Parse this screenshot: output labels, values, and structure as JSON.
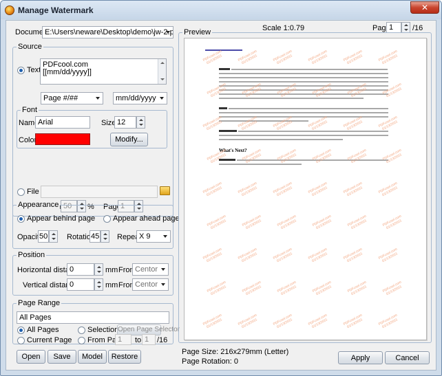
{
  "window": {
    "title": "Manage Watermark",
    "close_glyph": "✕"
  },
  "document": {
    "label": "Document",
    "path": "E:\\Users\\neware\\Desktop\\demo\\jw-2.pdf"
  },
  "source": {
    "title": "Source",
    "text_label": "Text",
    "text_line1": "PDFcool.com",
    "text_line2": "[[mm/dd/yyyy]]",
    "page_format": "Page #/##",
    "date_format": "mm/dd/yyyy",
    "font": {
      "title": "Font",
      "name_label": "Name",
      "name_value": "Arial",
      "size_label": "Size",
      "size_value": "12",
      "color_label": "Color",
      "color_hex": "#ff0000",
      "modify_label": "Modify..."
    },
    "file_label": "File",
    "scaling_label": "Scaling",
    "scaling_value": "50",
    "scaling_unit": "%",
    "page_label": "Page",
    "page_value": "1"
  },
  "appearance": {
    "title": "Appearance",
    "behind_label": "Appear behind page",
    "ahead_label": "Appear ahead page",
    "opacity_label": "Opacity",
    "opacity_value": "50",
    "rotation_label": "Rotation",
    "rotation_value": "45",
    "repeat_label": "Repeat",
    "repeat_value": "X 9"
  },
  "position": {
    "title": "Position",
    "h_label": "Horizontal distance",
    "h_value": "0",
    "h_unit": "mm",
    "h_from_label": "From",
    "h_from_value": "Centor",
    "v_label": "Vertical distance",
    "v_value": "0",
    "v_unit": "mm",
    "v_from_label": "From",
    "v_from_value": "Centor"
  },
  "page_range": {
    "title": "Page Range",
    "range_value": "All Pages",
    "all_pages_label": "All Pages",
    "selection_label": "Selection",
    "selector_label": "Open Page Selector",
    "current_page_label": "Current Page",
    "from_page_label": "From Page",
    "from_value": "1",
    "to_label": "to",
    "to_value": "1",
    "total": "/16"
  },
  "footer_buttons": {
    "open": "Open",
    "save": "Save",
    "model": "Model",
    "restore": "Restore"
  },
  "preview": {
    "title": "Preview",
    "scale": "Scale 1:0.79",
    "page_label": "Page",
    "page_value": "1",
    "page_total": "/16",
    "page_size": "Page Size: 216x279mm (Letter)",
    "page_rotation": "Page Rotation: 0",
    "watermark_line1": "PDFcool.com",
    "watermark_line2": "01/13/2011",
    "doc_heading": "What's Next?"
  },
  "actions": {
    "apply": "Apply",
    "cancel": "Cancel"
  }
}
